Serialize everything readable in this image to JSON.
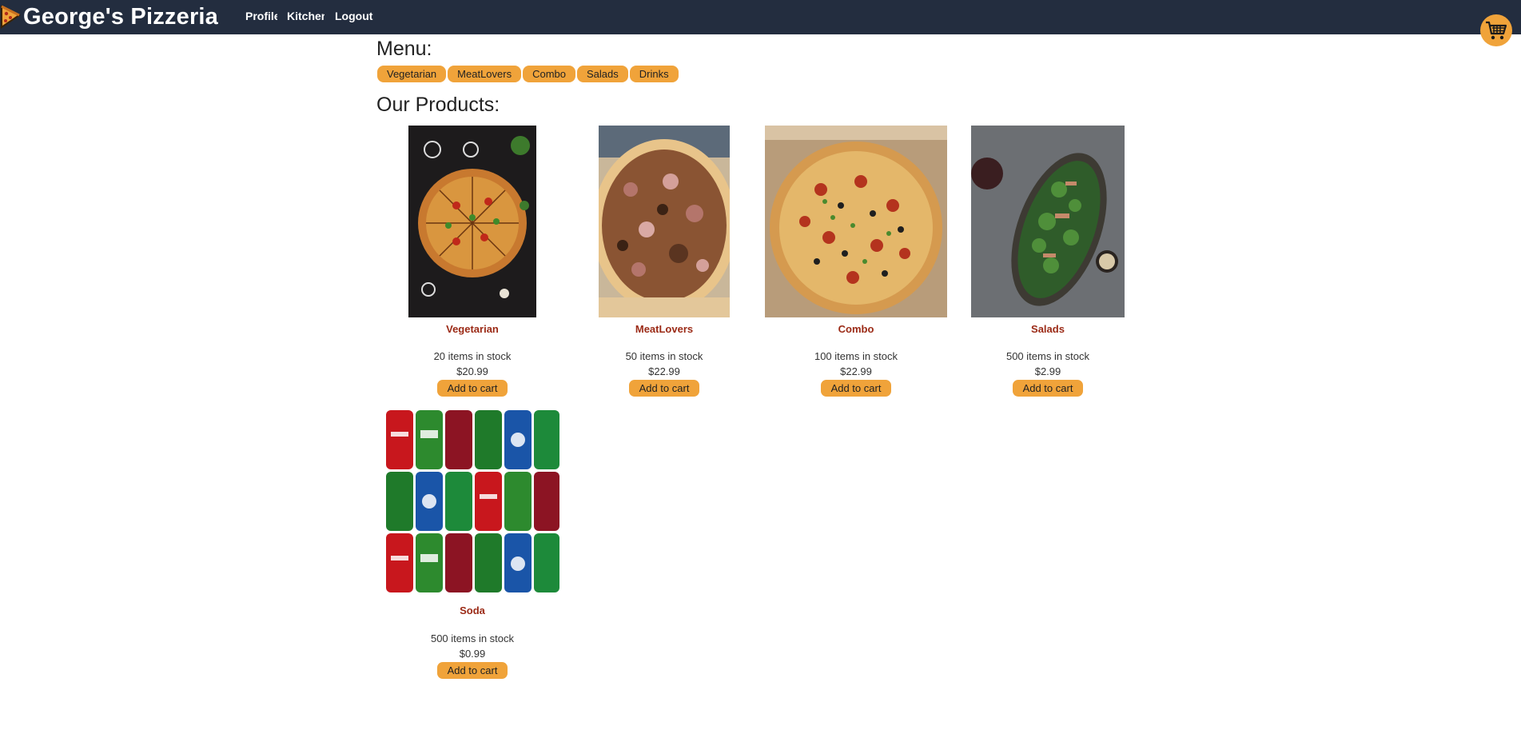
{
  "header": {
    "title": "George's Pizzeria",
    "logo_icon": "pizza-slice-icon",
    "nav": [
      {
        "label": "Profile"
      },
      {
        "label": "Kitchen"
      },
      {
        "label": "Logout"
      }
    ],
    "cart_icon": "shopping-cart-icon"
  },
  "menu": {
    "heading": "Menu:",
    "tabs": [
      {
        "label": "Vegetarian"
      },
      {
        "label": "MeatLovers"
      },
      {
        "label": "Combo"
      },
      {
        "label": "Salads"
      },
      {
        "label": "Drinks"
      }
    ]
  },
  "products": {
    "heading": "Our Products:",
    "items": [
      {
        "name": "Vegetarian",
        "stock": "20 items in stock",
        "price": "$20.99",
        "button": "Add to cart",
        "image": "vegetarian-pizza-photo"
      },
      {
        "name": "MeatLovers",
        "stock": "50 items in stock",
        "price": "$22.99",
        "button": "Add to cart",
        "image": "meatlovers-pizza-photo"
      },
      {
        "name": "Combo",
        "stock": "100 items in stock",
        "price": "$22.99",
        "button": "Add to cart",
        "image": "combo-pizza-photo"
      },
      {
        "name": "Salads",
        "stock": "500 items in stock",
        "price": "$2.99",
        "button": "Add to cart",
        "image": "salad-photo"
      },
      {
        "name": "Soda",
        "stock": "500 items in stock",
        "price": "$0.99",
        "button": "Add to cart",
        "image": "soda-cans-photo"
      }
    ]
  },
  "colors": {
    "topbar": "#232d3f",
    "accent": "#f0a33a",
    "product_name": "#9b2a16"
  }
}
